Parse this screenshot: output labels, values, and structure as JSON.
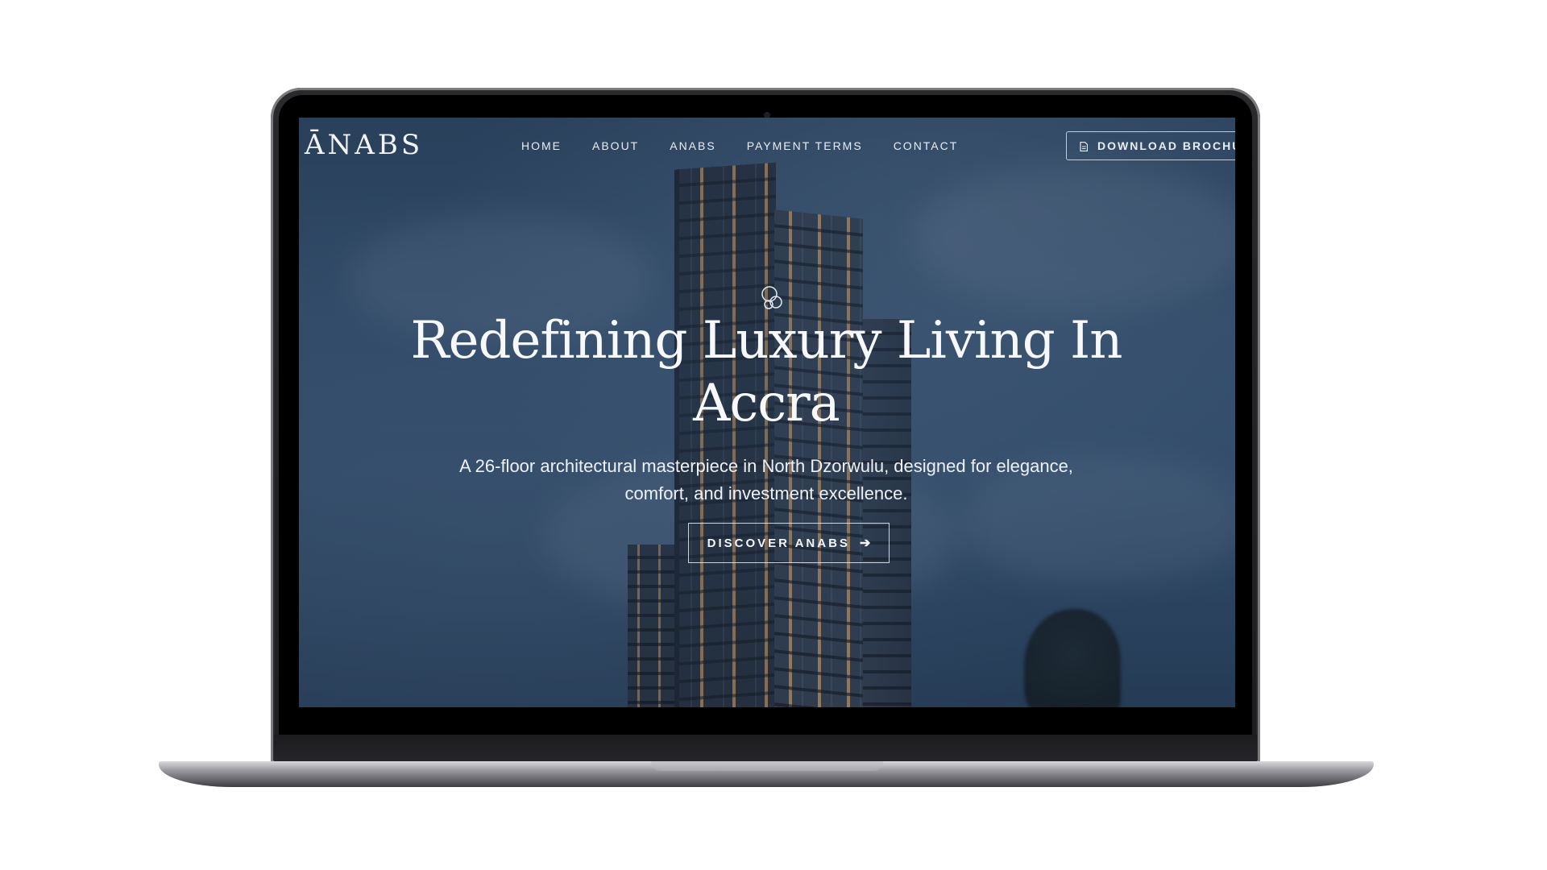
{
  "brand": {
    "logo_text": "ĀNABS"
  },
  "nav": {
    "items": [
      {
        "label": "HOME"
      },
      {
        "label": "ABOUT"
      },
      {
        "label": "ANABS"
      },
      {
        "label": "PAYMENT TERMS"
      },
      {
        "label": "CONTACT"
      }
    ],
    "cta_label": "DOWNLOAD BROCHU",
    "cta_icon": "document-icon"
  },
  "hero": {
    "title": "Redefining Luxury Living In Accra",
    "subtitle": "A 26-floor architectural masterpiece in North Dzorwulu, designed for elegance, comfort, and investment excellence.",
    "button_label": "DISCOVER ANABS",
    "button_icon": "arrow-right-icon",
    "mark_icon": "bubbles-icon"
  },
  "colors": {
    "hero_bg": "#3b5a7c",
    "text": "#f2f4f7",
    "window_light": "#d4a46a"
  }
}
